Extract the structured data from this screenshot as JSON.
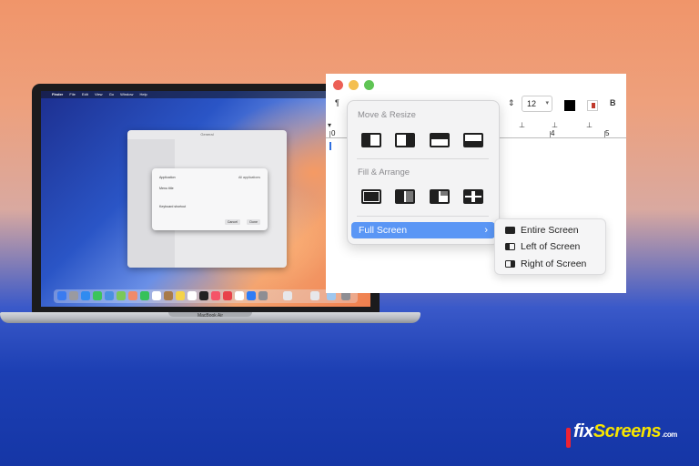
{
  "laptop": {
    "menubar_items": [
      "Finder",
      "File",
      "Edit",
      "View",
      "Go",
      "Window",
      "Help"
    ],
    "settings_title": "General",
    "sheet": {
      "rows": [
        {
          "label": "Application",
          "value": "All applications"
        },
        {
          "label": "Menu title",
          "value": ""
        },
        {
          "label": "Keyboard shortcut",
          "value": ""
        }
      ],
      "cancel_label": "Cancel",
      "done_label": "Done"
    },
    "base_label": "MacBook Air"
  },
  "editor": {
    "font_size_value": "12",
    "bold_label": "B",
    "ruler_numbers": [
      "0",
      "3",
      "4",
      "5"
    ],
    "paragraph_glyph": "¶"
  },
  "popover": {
    "move_resize_title": "Move & Resize",
    "fill_arrange_title": "Fill & Arrange",
    "full_screen_label": "Full Screen",
    "chevron": "›"
  },
  "submenu": {
    "items": [
      {
        "label": "Entire Screen",
        "icon": "entire-screen-icon"
      },
      {
        "label": "Left of Screen",
        "icon": "left-of-screen-icon"
      },
      {
        "label": "Right of Screen",
        "icon": "right-of-screen-icon"
      }
    ]
  },
  "brand": {
    "fix": "fix",
    "screens": "Screens",
    "com": ".com"
  },
  "colors": {
    "traffic_close": "#ec5f56",
    "traffic_minimize": "#f4bf4f",
    "traffic_zoom": "#5fc454",
    "highlight": "#5a96f5"
  }
}
